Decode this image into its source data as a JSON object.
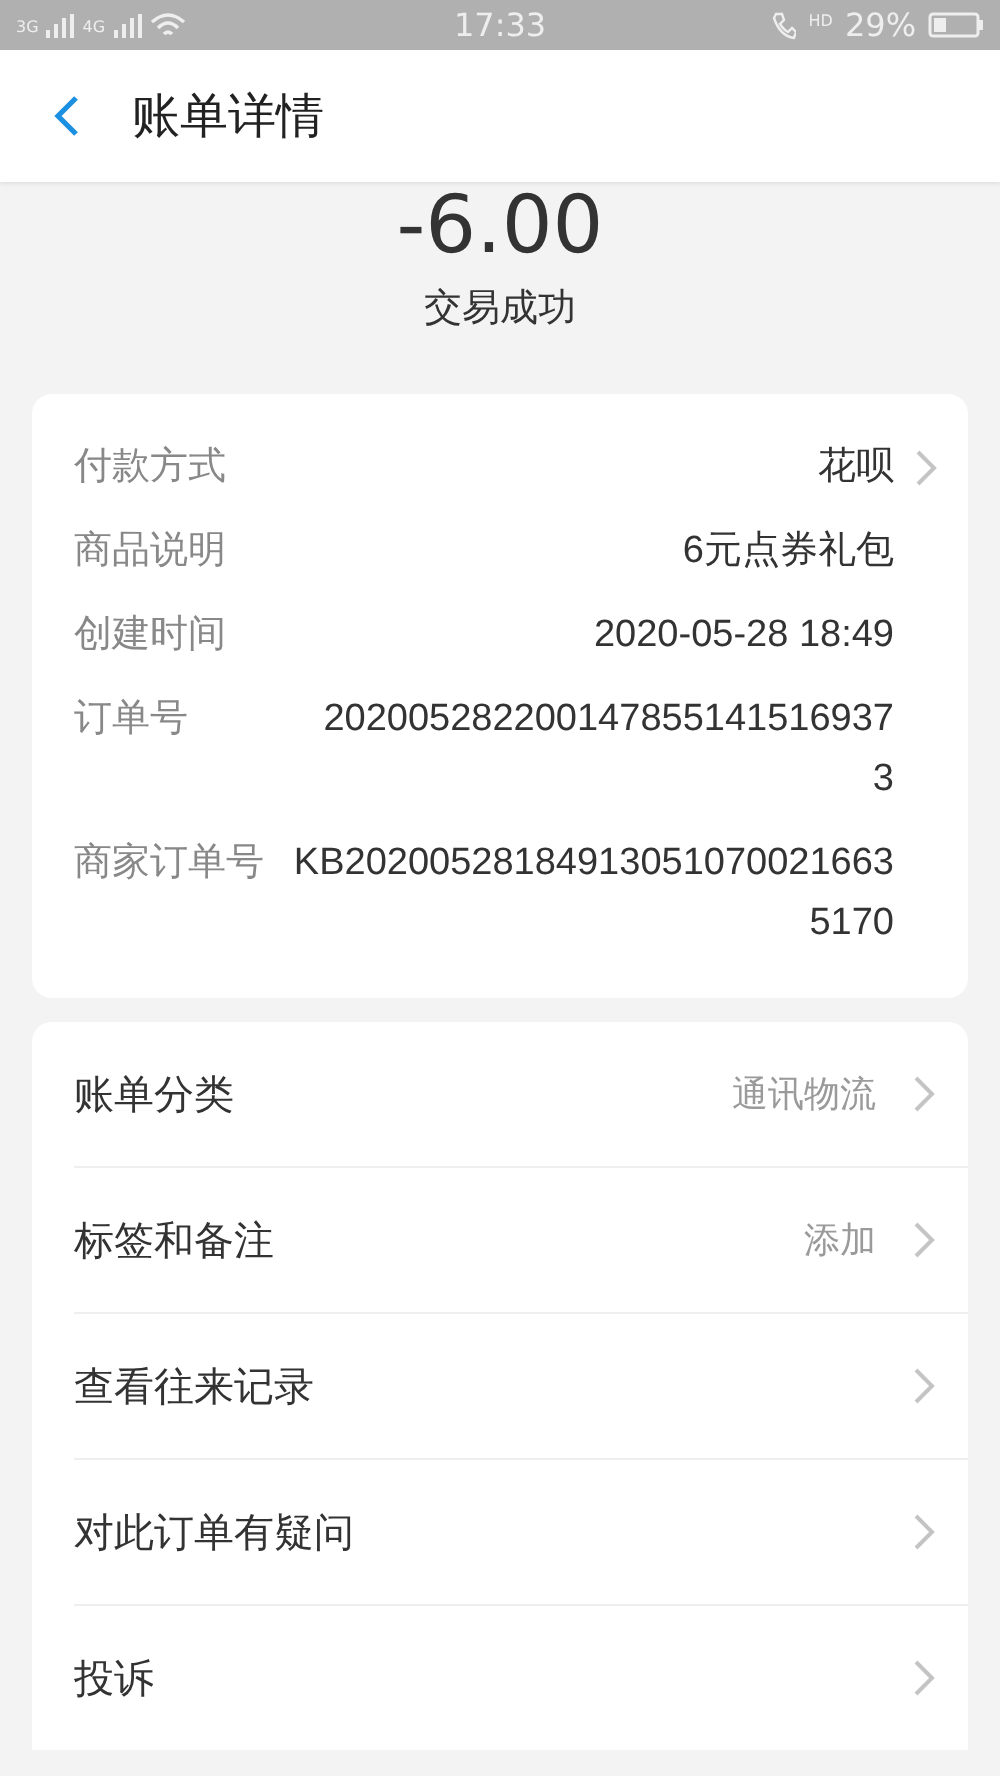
{
  "status_bar": {
    "network_1": "3G",
    "network_2": "4G",
    "time": "17:33",
    "call_badge": "HD",
    "battery": "29%"
  },
  "header": {
    "title": "账单详情"
  },
  "summary": {
    "amount": "-6.00",
    "status": "交易成功"
  },
  "details": [
    {
      "label": "付款方式",
      "value": "花呗",
      "kind": "link"
    },
    {
      "label": "商品说明",
      "value": "6元点券礼包",
      "kind": "plain"
    },
    {
      "label": "创建时间",
      "value": "2020-05-28 18:49",
      "kind": "plain"
    },
    {
      "label": "订单号",
      "value": "2020052822001478551415169373",
      "kind": "plain"
    },
    {
      "label": "商家订单号",
      "value": "KB202005281849130510700216635170",
      "kind": "plain"
    }
  ],
  "actions": [
    {
      "label": "账单分类",
      "value": "通讯物流"
    },
    {
      "label": "标签和备注",
      "value": "添加"
    },
    {
      "label": "查看往来记录"
    },
    {
      "label": "对此订单有疑问"
    },
    {
      "label": "投诉"
    }
  ]
}
